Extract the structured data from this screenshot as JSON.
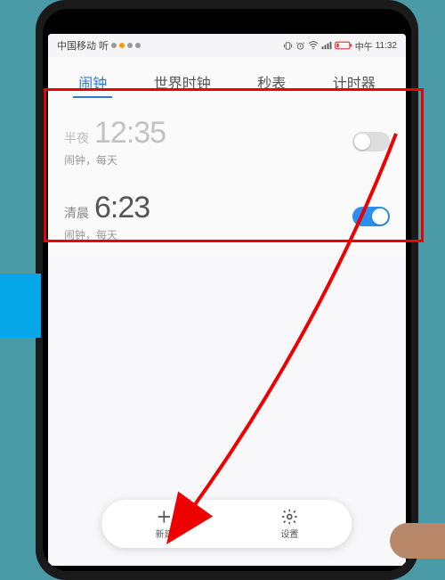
{
  "status": {
    "carrier": "中国移动",
    "ext": "听",
    "ampm": "中午",
    "time": "11:32"
  },
  "tabs": {
    "alarm": "闹钟",
    "world": "世界时钟",
    "stopwatch": "秒表",
    "timer": "计时器"
  },
  "alarms": [
    {
      "period": "半夜",
      "time": "12:35",
      "sub": "闹钟，每天",
      "on": false
    },
    {
      "period": "清晨",
      "time": "6:23",
      "sub": "闹钟，每天",
      "on": true
    }
  ],
  "bottom": {
    "new": "新建",
    "settings": "设置"
  }
}
